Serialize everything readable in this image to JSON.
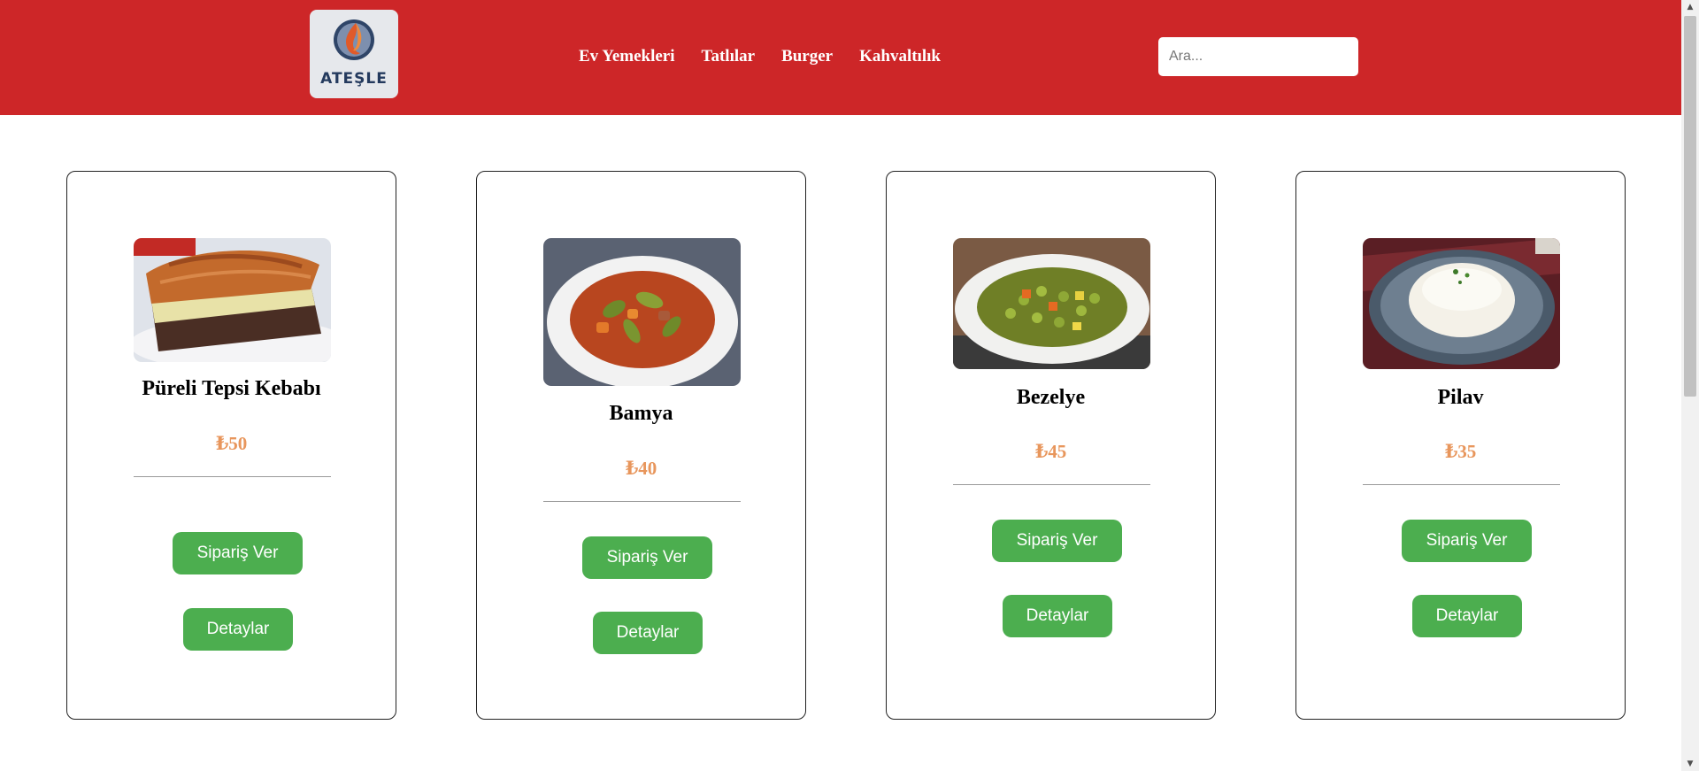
{
  "brand": {
    "logo_text": "ATEŞLE",
    "icon": "flame-logo-icon",
    "color": "#cd2628"
  },
  "nav": [
    {
      "label": "Ev Yemekleri"
    },
    {
      "label": "Tatlılar"
    },
    {
      "label": "Burger"
    },
    {
      "label": "Kahvaltılık"
    }
  ],
  "search": {
    "placeholder": "Ara...",
    "value": ""
  },
  "products": [
    {
      "name": "Püreli Tepsi Kebabı",
      "price": "₺50",
      "image": "pureli-tepsi-kebabi-photo",
      "order_label": "Sipariş Ver",
      "details_label": "Detaylar"
    },
    {
      "name": "Bamya",
      "price": "₺40",
      "image": "bamya-photo",
      "order_label": "Sipariş Ver",
      "details_label": "Detaylar"
    },
    {
      "name": "Bezelye",
      "price": "₺45",
      "image": "bezelye-photo",
      "order_label": "Sipariş Ver",
      "details_label": "Detaylar"
    },
    {
      "name": "Pilav",
      "price": "₺35",
      "image": "pilav-photo",
      "order_label": "Sipariş Ver",
      "details_label": "Detaylar"
    }
  ],
  "colors": {
    "header": "#cd2628",
    "button": "#4cae4f",
    "price": "#e8965c"
  }
}
